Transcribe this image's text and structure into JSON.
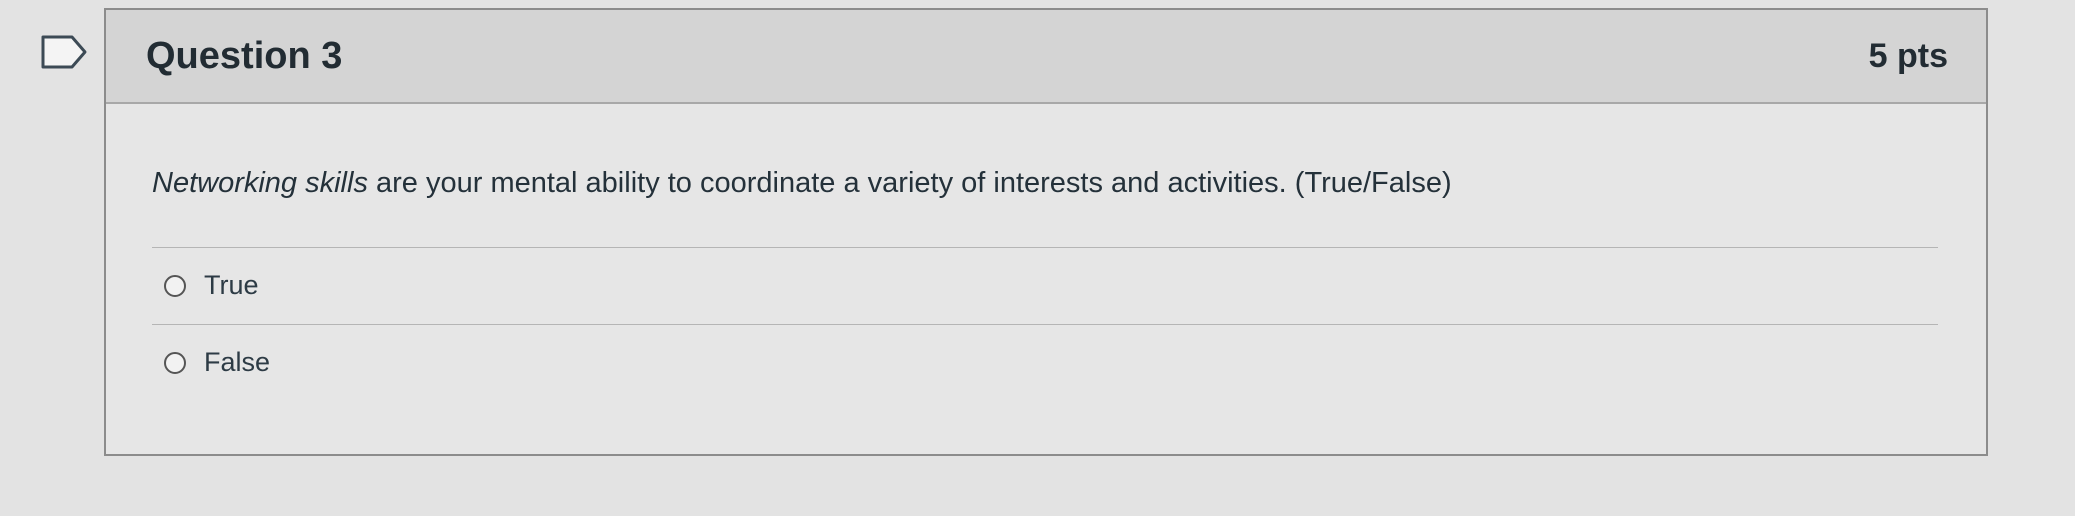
{
  "question": {
    "title": "Question 3",
    "points": "5 pts",
    "text_emphasis": "Networking skills",
    "text_rest": " are your mental ability to coordinate a variety of interests and activities. (True/False)",
    "answers": [
      {
        "label": "True",
        "selected": false
      },
      {
        "label": "False",
        "selected": false
      }
    ]
  },
  "icons": {
    "flag": "flag-question-icon"
  },
  "colors": {
    "header_bg": "#d4d4d4",
    "body_bg": "#e6e6e6",
    "text": "#2d3b45"
  }
}
